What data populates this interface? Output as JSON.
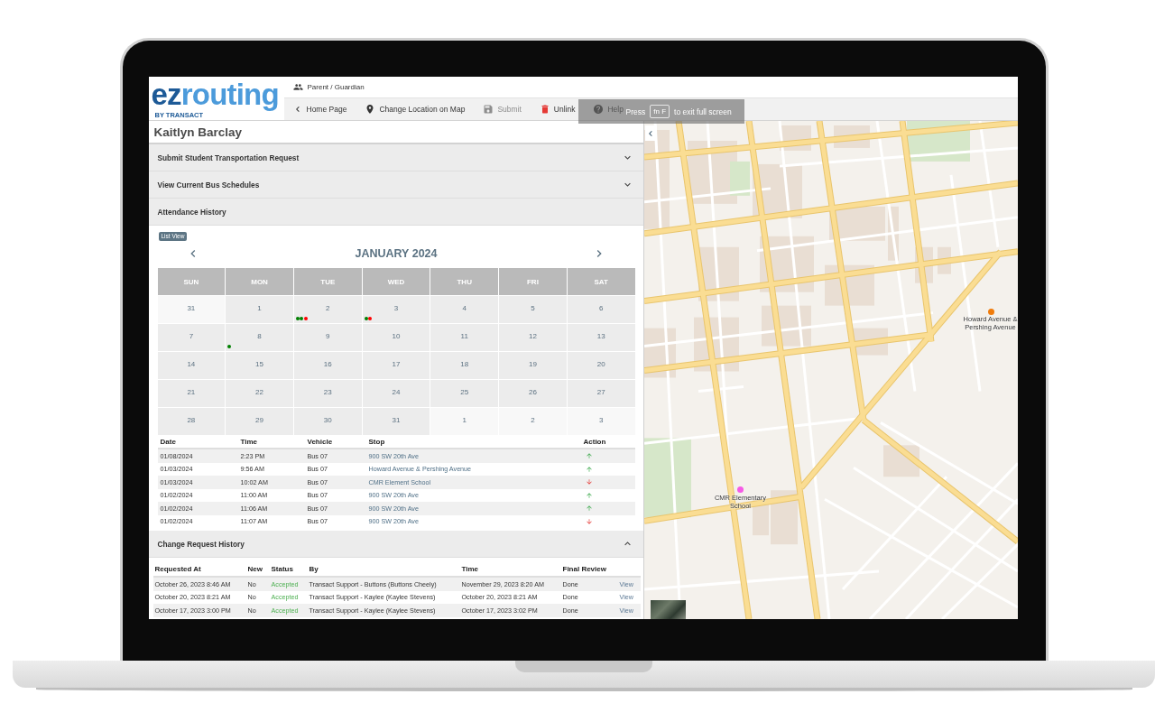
{
  "header": {
    "logo": {
      "text_dark": "ez",
      "text_light": "routing",
      "tagline": "BY TRANSACT"
    },
    "role": "Parent / Guardian",
    "toolbar": [
      {
        "kind": "back",
        "label": "Home Page",
        "disabled": false
      },
      {
        "kind": "location",
        "label": "Change Location on Map",
        "disabled": false
      },
      {
        "kind": "save",
        "label": "Submit",
        "disabled": true
      },
      {
        "kind": "unlink",
        "label": "Unlink",
        "disabled": false
      },
      {
        "kind": "help",
        "label": "Help",
        "disabled": false
      }
    ]
  },
  "fullscreen_notice": {
    "prefix": "Press",
    "key": "fn F",
    "suffix": "to exit full screen"
  },
  "student": {
    "name": "Kaitlyn Barclay"
  },
  "sections": [
    {
      "kind": "form",
      "title": "Submit Student Transportation Request",
      "collapsible": true,
      "expanded": false
    },
    {
      "kind": "schedules",
      "title": "View Current Bus Schedules",
      "collapsible": true,
      "expanded": false
    },
    {
      "kind": "attendance",
      "title": "Attendance History",
      "collapsible": false,
      "expanded": true,
      "view_toggle": "List View",
      "calendar": {
        "month": "JANUARY 2024",
        "weekdays": [
          "SUN",
          "MON",
          "TUE",
          "WED",
          "THU",
          "FRI",
          "SAT"
        ],
        "weeks": [
          [
            {
              "day": "31",
              "outside": true
            },
            {
              "day": "1",
              "outside": false
            },
            {
              "day": "2",
              "outside": false,
              "dots": [
                {
                  "color": "#008000"
                },
                {
                  "color": "#008000"
                },
                {
                  "color": "#ff0000"
                }
              ]
            },
            {
              "day": "3",
              "outside": false,
              "dots": [
                {
                  "color": "#008000"
                },
                {
                  "color": "#ff0000"
                }
              ]
            },
            {
              "day": "4",
              "outside": false
            },
            {
              "day": "5",
              "outside": false
            },
            {
              "day": "6",
              "outside": false
            }
          ],
          [
            {
              "day": "7",
              "outside": false
            },
            {
              "day": "8",
              "outside": false,
              "dots": [
                {
                  "color": "#008000"
                }
              ]
            },
            {
              "day": "9",
              "outside": false
            },
            {
              "day": "10",
              "outside": false
            },
            {
              "day": "11",
              "outside": false
            },
            {
              "day": "12",
              "outside": false
            },
            {
              "day": "13",
              "outside": false
            }
          ],
          [
            {
              "day": "14",
              "outside": false
            },
            {
              "day": "15",
              "outside": false
            },
            {
              "day": "16",
              "outside": false
            },
            {
              "day": "17",
              "outside": false
            },
            {
              "day": "18",
              "outside": false
            },
            {
              "day": "19",
              "outside": false
            },
            {
              "day": "20",
              "outside": false
            }
          ],
          [
            {
              "day": "21",
              "outside": false
            },
            {
              "day": "22",
              "outside": false
            },
            {
              "day": "23",
              "outside": false
            },
            {
              "day": "24",
              "outside": false
            },
            {
              "day": "25",
              "outside": false
            },
            {
              "day": "26",
              "outside": false
            },
            {
              "day": "27",
              "outside": false
            }
          ],
          [
            {
              "day": "28",
              "outside": false
            },
            {
              "day": "29",
              "outside": false
            },
            {
              "day": "30",
              "outside": false
            },
            {
              "day": "31",
              "outside": false
            },
            {
              "day": "1",
              "outside": true
            },
            {
              "day": "2",
              "outside": true
            },
            {
              "day": "3",
              "outside": true
            }
          ]
        ]
      },
      "table": {
        "columns": [
          "Date",
          "Time",
          "Vehicle",
          "Stop",
          "Action"
        ],
        "rows": [
          {
            "date": "01/08/2024",
            "time": "2:23 PM",
            "vehicle": "Bus 07",
            "stop": "900 SW 20th Ave",
            "boarding": true
          },
          {
            "date": "01/03/2024",
            "time": "9:56 AM",
            "vehicle": "Bus 07",
            "stop": "Howard Avenue & Pershing Avenue",
            "boarding": true
          },
          {
            "date": "01/03/2024",
            "time": "10:02 AM",
            "vehicle": "Bus 07",
            "stop": "CMR Element School",
            "boarding": false
          },
          {
            "date": "01/02/2024",
            "time": "11:00 AM",
            "vehicle": "Bus 07",
            "stop": "900 SW 20th Ave",
            "boarding": true
          },
          {
            "date": "01/02/2024",
            "time": "11:06 AM",
            "vehicle": "Bus 07",
            "stop": "900 SW 20th Ave",
            "boarding": true
          },
          {
            "date": "01/02/2024",
            "time": "11:07 AM",
            "vehicle": "Bus 07",
            "stop": "900 SW 20th Ave",
            "boarding": false
          }
        ]
      }
    },
    {
      "kind": "requests",
      "title": "Change Request History",
      "collapsible": true,
      "expanded": true,
      "table": {
        "columns": [
          "Requested At",
          "New",
          "Status",
          "By",
          "Time",
          "Final Review"
        ],
        "rows": [
          {
            "requested_at": "October 26, 2023 8:46 AM",
            "new": "No",
            "status": "Accepted",
            "by": "Transact Support - Buttons (Buttons Cheely)",
            "time": "November 29, 2023 8:20 AM",
            "final_review": "Done",
            "link": "View"
          },
          {
            "requested_at": "October 20, 2023 8:21 AM",
            "new": "No",
            "status": "Accepted",
            "by": "Transact Support - Kaylee (Kaylee Stevens)",
            "time": "October 20, 2023 8:21 AM",
            "final_review": "Done",
            "link": "View"
          },
          {
            "requested_at": "October 17, 2023 3:00 PM",
            "new": "No",
            "status": "Accepted",
            "by": "Transact Support - Kaylee (Kaylee Stevens)",
            "time": "October 17, 2023 3:02 PM",
            "final_review": "Done",
            "link": "View"
          }
        ]
      }
    }
  ],
  "map": {
    "markers": [
      {
        "label": "Howard Avenue & Pershing Avenue",
        "color": "#f07c0c"
      },
      {
        "label": "CMR Elementary School",
        "color": "#f55be6"
      }
    ]
  }
}
